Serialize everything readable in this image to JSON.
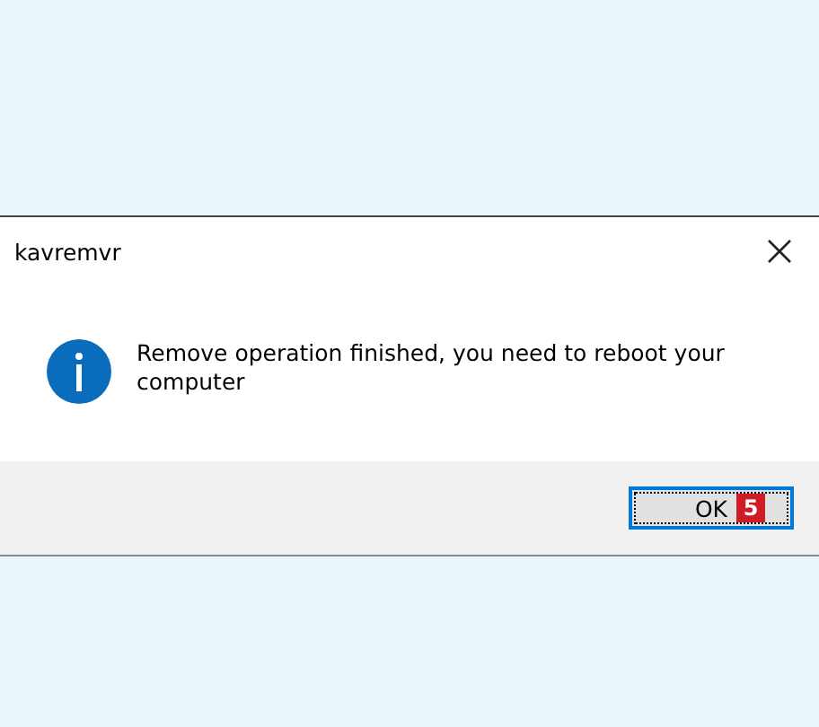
{
  "dialog": {
    "title": "kavremvr",
    "kind": "info",
    "message": "Remove operation finished, you need to reboot your computer",
    "buttons": [
      {
        "label": "OK",
        "focused": true,
        "badge": "5"
      }
    ]
  }
}
